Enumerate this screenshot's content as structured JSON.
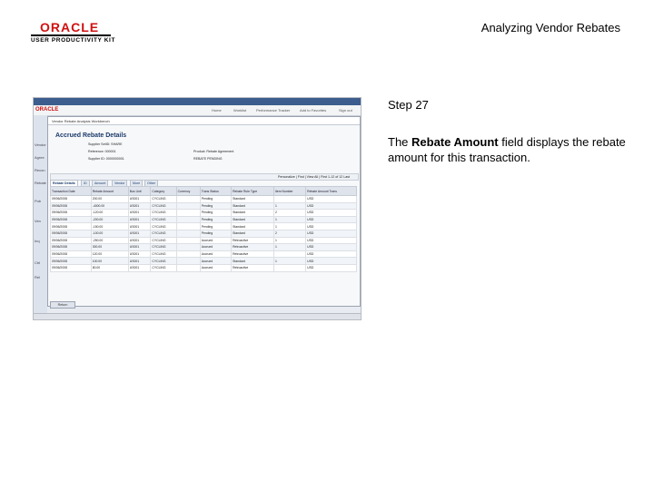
{
  "logo": {
    "wordmark": "ORACLE",
    "subtitle": "USER PRODUCTIVITY KIT"
  },
  "doc_title": "Analyzing Vendor Rebates",
  "step": {
    "title": "Step 27",
    "desc_before": "The ",
    "desc_bold": "Rebate Amount",
    "desc_after": " field displays the rebate amount for this transaction."
  },
  "shot": {
    "window_title": "Vendor Rebate Analysis Workbench",
    "page_header": "Accrued Rebate Details",
    "brand": "ORACLE",
    "nav_links": [
      "Home",
      "Worklist",
      "Performance Tracker",
      "Add to Favorites",
      "Sign out"
    ],
    "left_nav": [
      "Vendor",
      "Agree",
      "Recon",
      "Rebate",
      "Pub",
      "Ven",
      "Inq",
      "Ctrl",
      "Rel"
    ],
    "info_lines": [
      "Supplier SetID: SHARE",
      "Reference: 000001",
      "Supplier ID: 0000000001"
    ],
    "info_right": [
      "Product: Rebate Agreement",
      "REBATE PENDING"
    ],
    "grid_controls": "Personalize | Find | View All | First 1-12 of 12 Last",
    "tabs": [
      "Rebate Details",
      "ID",
      "Amount",
      "Vendor",
      "More",
      "Other"
    ],
    "columns": [
      "Transaction Date",
      "Rebate Amount",
      "Bus Unit",
      "Category",
      "Currency",
      "Trans Status",
      "Rebate Rule Type",
      "Item Number",
      "Rebate Amount Trans"
    ],
    "rows": [
      [
        "09/06/2008",
        "200.00",
        "US001",
        "CYCLING",
        "",
        "Pending",
        "Standard",
        "",
        "USD"
      ],
      [
        "09/06/2008",
        "-4000.00",
        "US001",
        "CYCLING",
        "",
        "Pending",
        "Standard",
        "1",
        "USD"
      ],
      [
        "09/06/2008",
        "-120.00",
        "US001",
        "CYCLING",
        "",
        "Pending",
        "Standard",
        "2",
        "USD"
      ],
      [
        "09/06/2008",
        "-200.00",
        "US001",
        "CYCLING",
        "",
        "Pending",
        "Standard",
        "1",
        "USD"
      ],
      [
        "09/06/2008",
        "-150.00",
        "US001",
        "CYCLING",
        "",
        "Pending",
        "Standard",
        "1",
        "USD"
      ],
      [
        "09/06/2008",
        "-100.00",
        "US001",
        "CYCLING",
        "",
        "Pending",
        "Standard",
        "2",
        "USD"
      ],
      [
        "09/06/2008",
        "-250.00",
        "US001",
        "CYCLING",
        "",
        "Accrued",
        "Retroactive",
        "1",
        "USD"
      ],
      [
        "09/06/2008",
        "300.00",
        "US001",
        "CYCLING",
        "",
        "Accrued",
        "Retroactive",
        "1",
        "USD"
      ],
      [
        "09/06/2008",
        "120.00",
        "US001",
        "CYCLING",
        "",
        "Accrued",
        "Retroactive",
        "",
        "USD"
      ],
      [
        "09/06/2008",
        "100.00",
        "US001",
        "CYCLING",
        "",
        "Accrued",
        "Standard",
        "1",
        "USD"
      ],
      [
        "09/06/2008",
        "80.00",
        "US001",
        "CYCLING",
        "",
        "Accrued",
        "Retroactive",
        "",
        "USD"
      ]
    ],
    "return_button": "Return"
  }
}
